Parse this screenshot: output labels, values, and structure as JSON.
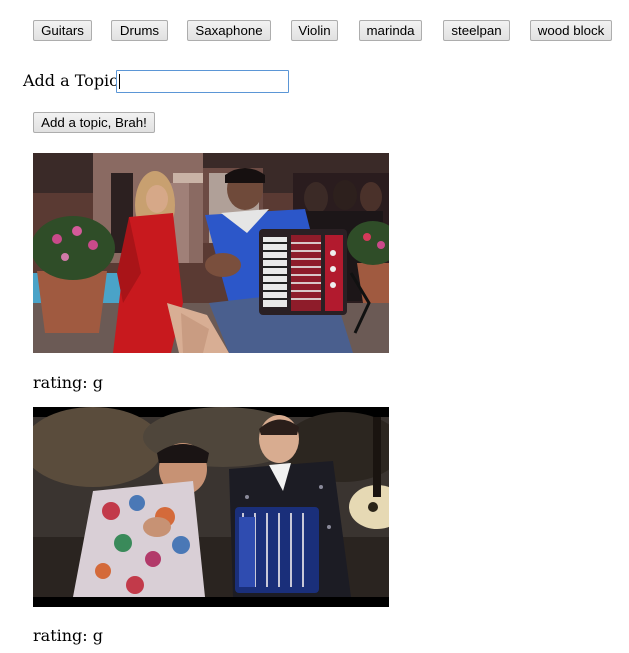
{
  "topics": [
    {
      "label": "Guitars"
    },
    {
      "label": "Drums"
    },
    {
      "label": "Saxaphone"
    },
    {
      "label": "Violin"
    },
    {
      "label": "marinda"
    },
    {
      "label": "steelpan"
    },
    {
      "label": "wood block"
    }
  ],
  "add_topic": {
    "label": "Add a Topic",
    "value": "",
    "submit_label": "Add a topic, Brah!"
  },
  "gifs": [
    {
      "rating_text": "rating: g"
    },
    {
      "rating_text": "rating: g"
    }
  ]
}
